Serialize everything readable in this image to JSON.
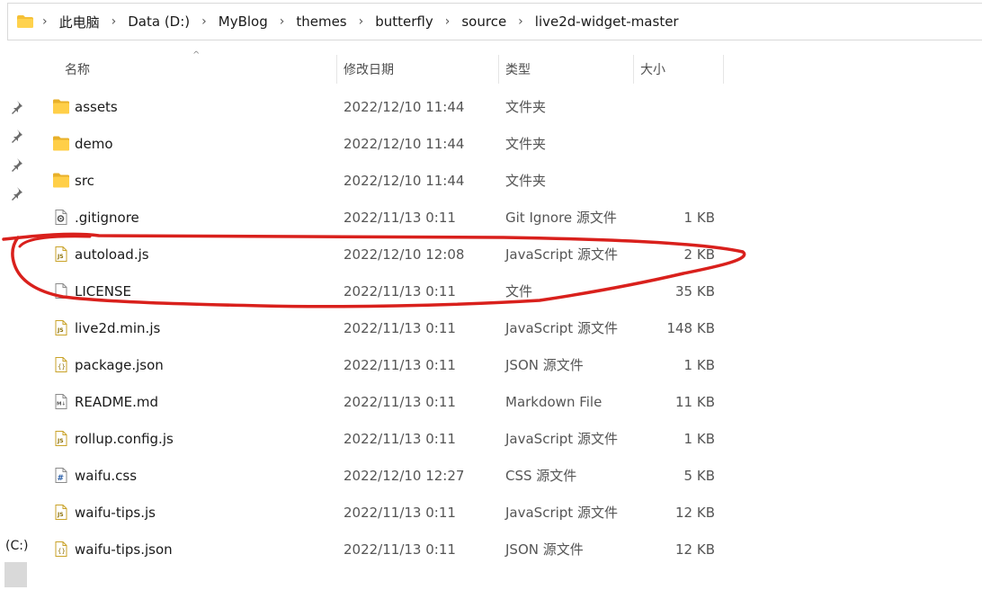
{
  "address": {
    "crumbs": [
      "此电脑",
      "Data (D:)",
      "MyBlog",
      "themes",
      "butterfly",
      "source",
      "live2d-widget-master"
    ]
  },
  "columns": {
    "name": "名称",
    "date": "修改日期",
    "type": "类型",
    "size": "大小"
  },
  "nav": {
    "drive_label": "(C:)"
  },
  "files": [
    {
      "name": "assets",
      "date": "2022/12/10 11:44",
      "type": "文件夹",
      "size": "",
      "icon": "folder-icon"
    },
    {
      "name": "demo",
      "date": "2022/12/10 11:44",
      "type": "文件夹",
      "size": "",
      "icon": "folder-icon"
    },
    {
      "name": "src",
      "date": "2022/12/10 11:44",
      "type": "文件夹",
      "size": "",
      "icon": "folder-icon"
    },
    {
      "name": ".gitignore",
      "date": "2022/11/13 0:11",
      "type": "Git Ignore 源文件",
      "size": "1 KB",
      "icon": "gear-file-icon"
    },
    {
      "name": "autoload.js",
      "date": "2022/12/10 12:08",
      "type": "JavaScript 源文件",
      "size": "2 KB",
      "icon": "js-file-icon"
    },
    {
      "name": "LICENSE",
      "date": "2022/11/13 0:11",
      "type": "文件",
      "size": "35 KB",
      "icon": "blank-file-icon"
    },
    {
      "name": "live2d.min.js",
      "date": "2022/11/13 0:11",
      "type": "JavaScript 源文件",
      "size": "148 KB",
      "icon": "js-file-icon"
    },
    {
      "name": "package.json",
      "date": "2022/11/13 0:11",
      "type": "JSON 源文件",
      "size": "1 KB",
      "icon": "json-file-icon"
    },
    {
      "name": "README.md",
      "date": "2022/11/13 0:11",
      "type": "Markdown File",
      "size": "11 KB",
      "icon": "markdown-file-icon"
    },
    {
      "name": "rollup.config.js",
      "date": "2022/11/13 0:11",
      "type": "JavaScript 源文件",
      "size": "1 KB",
      "icon": "js-file-icon"
    },
    {
      "name": "waifu.css",
      "date": "2022/12/10 12:27",
      "type": "CSS 源文件",
      "size": "5 KB",
      "icon": "css-file-icon"
    },
    {
      "name": "waifu-tips.js",
      "date": "2022/11/13 0:11",
      "type": "JavaScript 源文件",
      "size": "12 KB",
      "icon": "js-file-icon"
    },
    {
      "name": "waifu-tips.json",
      "date": "2022/11/13 0:11",
      "type": "JSON 源文件",
      "size": "12 KB",
      "icon": "json-file-icon"
    }
  ],
  "annotation": {
    "color": "#d9201c"
  }
}
